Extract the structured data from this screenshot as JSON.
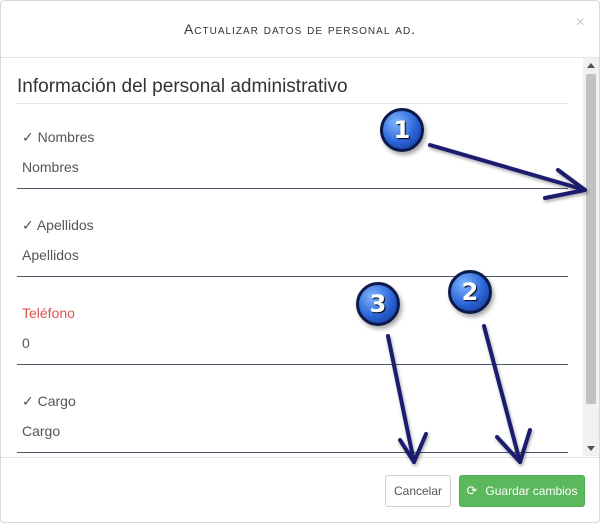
{
  "modal": {
    "title": "Actualizar datos de personal ad.",
    "close": "×"
  },
  "form": {
    "section_title": "Información del personal administrativo",
    "fields": [
      {
        "label": "✓ Nombres",
        "value": "Nombres",
        "status": "valid"
      },
      {
        "label": "✓ Apellidos",
        "value": "Apellidos",
        "status": "valid"
      },
      {
        "label": "Teléfono",
        "value": "0",
        "status": "error"
      },
      {
        "label": "✓ Cargo",
        "value": "Cargo",
        "status": "valid"
      }
    ]
  },
  "footer": {
    "cancel_label": "Cancelar",
    "save_label": "Guardar cambios",
    "save_icon": "refresh-icon"
  },
  "annotations": {
    "badges": [
      "1",
      "2",
      "3"
    ]
  },
  "colors": {
    "success": "#5cb85c",
    "error": "#d9534f",
    "annotation": "#1a1a6e"
  }
}
